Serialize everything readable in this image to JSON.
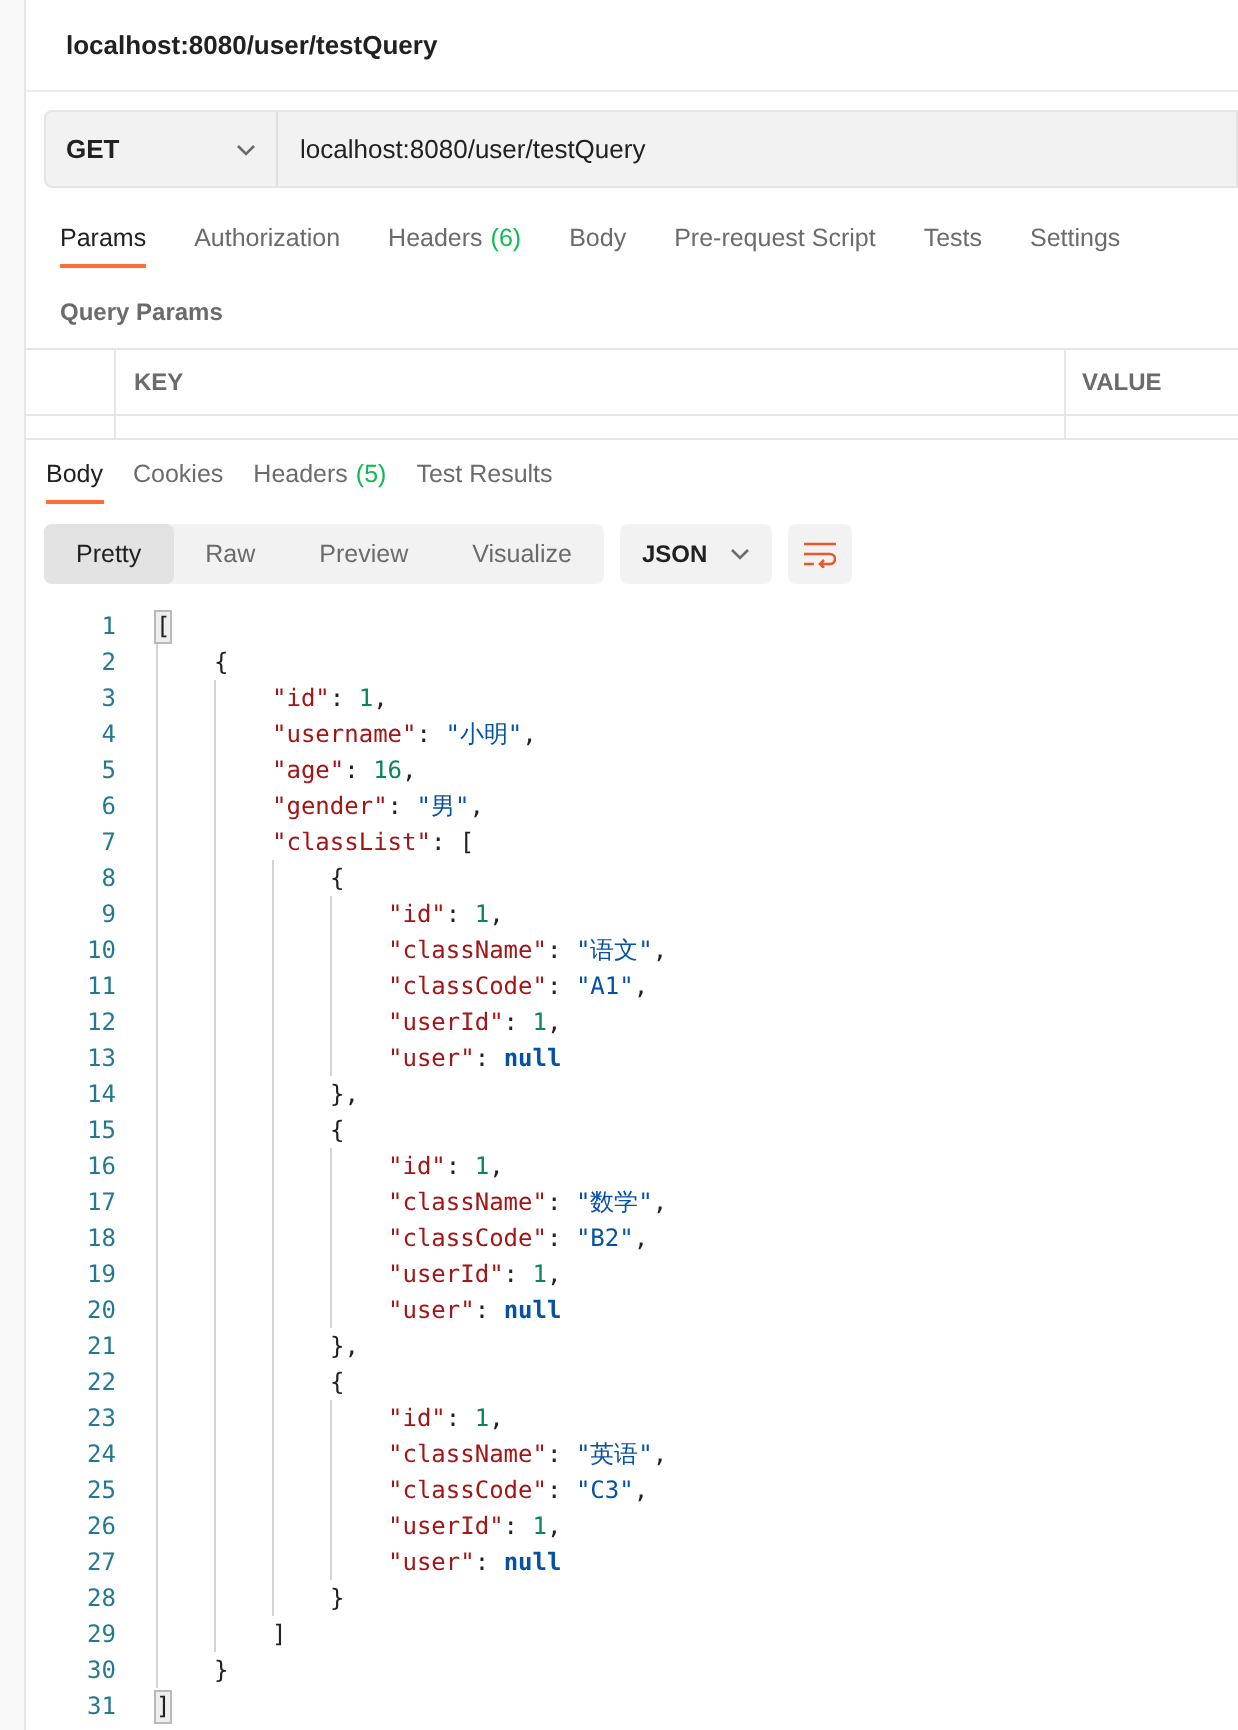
{
  "request_title": "localhost:8080/user/testQuery",
  "request_bar": {
    "method": "GET",
    "url": "localhost:8080/user/testQuery"
  },
  "request_tabs": [
    {
      "label": "Params",
      "selected": true
    },
    {
      "label": "Authorization",
      "selected": false
    },
    {
      "label": "Headers",
      "count": "(6)",
      "selected": false
    },
    {
      "label": "Body",
      "selected": false
    },
    {
      "label": "Pre-request Script",
      "selected": false
    },
    {
      "label": "Tests",
      "selected": false
    },
    {
      "label": "Settings",
      "selected": false
    }
  ],
  "query_params": {
    "title": "Query Params",
    "columns": [
      "KEY",
      "VALUE"
    ]
  },
  "response_tabs": [
    {
      "label": "Body",
      "selected": true
    },
    {
      "label": "Cookies",
      "selected": false
    },
    {
      "label": "Headers",
      "count": "(5)",
      "selected": false
    },
    {
      "label": "Test Results",
      "selected": false
    }
  ],
  "view_modes": [
    {
      "label": "Pretty",
      "selected": true
    },
    {
      "label": "Raw",
      "selected": false
    },
    {
      "label": "Preview",
      "selected": false
    },
    {
      "label": "Visualize",
      "selected": false
    }
  ],
  "format": "JSON",
  "code": [
    {
      "number": "1",
      "highlighted": true,
      "tokens": [
        {
          "kind": "punct",
          "text": "["
        }
      ],
      "children": [
        {
          "number": "2",
          "highlighted": false,
          "tokens": [
            {
              "kind": "punct",
              "text": "{"
            }
          ],
          "children": [
            {
              "number": "3",
              "highlighted": false,
              "tokens": [
                {
                  "kind": "key",
                  "text": "\"id\""
                },
                {
                  "kind": "punct",
                  "text": ": "
                },
                {
                  "kind": "number",
                  "text": "1"
                },
                {
                  "kind": "punct",
                  "text": ","
                }
              ]
            },
            {
              "number": "4",
              "highlighted": false,
              "tokens": [
                {
                  "kind": "key",
                  "text": "\"username\""
                },
                {
                  "kind": "punct",
                  "text": ": "
                },
                {
                  "kind": "string",
                  "text": "\"小明\""
                },
                {
                  "kind": "punct",
                  "text": ","
                }
              ]
            },
            {
              "number": "5",
              "highlighted": false,
              "tokens": [
                {
                  "kind": "key",
                  "text": "\"age\""
                },
                {
                  "kind": "punct",
                  "text": ": "
                },
                {
                  "kind": "number",
                  "text": "16"
                },
                {
                  "kind": "punct",
                  "text": ","
                }
              ]
            },
            {
              "number": "6",
              "highlighted": false,
              "tokens": [
                {
                  "kind": "key",
                  "text": "\"gender\""
                },
                {
                  "kind": "punct",
                  "text": ": "
                },
                {
                  "kind": "string",
                  "text": "\"男\""
                },
                {
                  "kind": "punct",
                  "text": ","
                }
              ]
            },
            {
              "number": "7",
              "highlighted": false,
              "tokens": [
                {
                  "kind": "key",
                  "text": "\"classList\""
                },
                {
                  "kind": "punct",
                  "text": ": ["
                }
              ],
              "children": [
                {
                  "number": "8",
                  "highlighted": false,
                  "tokens": [
                    {
                      "kind": "punct",
                      "text": "{"
                    }
                  ],
                  "children": [
                    {
                      "number": "9",
                      "highlighted": false,
                      "tokens": [
                        {
                          "kind": "key",
                          "text": "\"id\""
                        },
                        {
                          "kind": "punct",
                          "text": ": "
                        },
                        {
                          "kind": "number",
                          "text": "1"
                        },
                        {
                          "kind": "punct",
                          "text": ","
                        }
                      ]
                    },
                    {
                      "number": "10",
                      "highlighted": false,
                      "tokens": [
                        {
                          "kind": "key",
                          "text": "\"className\""
                        },
                        {
                          "kind": "punct",
                          "text": ": "
                        },
                        {
                          "kind": "string",
                          "text": "\"语文\""
                        },
                        {
                          "kind": "punct",
                          "text": ","
                        }
                      ]
                    },
                    {
                      "number": "11",
                      "highlighted": false,
                      "tokens": [
                        {
                          "kind": "key",
                          "text": "\"classCode\""
                        },
                        {
                          "kind": "punct",
                          "text": ": "
                        },
                        {
                          "kind": "string",
                          "text": "\"A1\""
                        },
                        {
                          "kind": "punct",
                          "text": ","
                        }
                      ]
                    },
                    {
                      "number": "12",
                      "highlighted": false,
                      "tokens": [
                        {
                          "kind": "key",
                          "text": "\"userId\""
                        },
                        {
                          "kind": "punct",
                          "text": ": "
                        },
                        {
                          "kind": "number",
                          "text": "1"
                        },
                        {
                          "kind": "punct",
                          "text": ","
                        }
                      ]
                    },
                    {
                      "number": "13",
                      "highlighted": false,
                      "tokens": [
                        {
                          "kind": "key",
                          "text": "\"user\""
                        },
                        {
                          "kind": "punct",
                          "text": ": "
                        },
                        {
                          "kind": "null",
                          "text": "null"
                        }
                      ]
                    }
                  ]
                },
                {
                  "number": "14",
                  "highlighted": false,
                  "tokens": [
                    {
                      "kind": "punct",
                      "text": "},"
                    }
                  ]
                },
                {
                  "number": "15",
                  "highlighted": false,
                  "tokens": [
                    {
                      "kind": "punct",
                      "text": "{"
                    }
                  ],
                  "children": [
                    {
                      "number": "16",
                      "highlighted": false,
                      "tokens": [
                        {
                          "kind": "key",
                          "text": "\"id\""
                        },
                        {
                          "kind": "punct",
                          "text": ": "
                        },
                        {
                          "kind": "number",
                          "text": "1"
                        },
                        {
                          "kind": "punct",
                          "text": ","
                        }
                      ]
                    },
                    {
                      "number": "17",
                      "highlighted": false,
                      "tokens": [
                        {
                          "kind": "key",
                          "text": "\"className\""
                        },
                        {
                          "kind": "punct",
                          "text": ": "
                        },
                        {
                          "kind": "string",
                          "text": "\"数学\""
                        },
                        {
                          "kind": "punct",
                          "text": ","
                        }
                      ]
                    },
                    {
                      "number": "18",
                      "highlighted": false,
                      "tokens": [
                        {
                          "kind": "key",
                          "text": "\"classCode\""
                        },
                        {
                          "kind": "punct",
                          "text": ": "
                        },
                        {
                          "kind": "string",
                          "text": "\"B2\""
                        },
                        {
                          "kind": "punct",
                          "text": ","
                        }
                      ]
                    },
                    {
                      "number": "19",
                      "highlighted": false,
                      "tokens": [
                        {
                          "kind": "key",
                          "text": "\"userId\""
                        },
                        {
                          "kind": "punct",
                          "text": ": "
                        },
                        {
                          "kind": "number",
                          "text": "1"
                        },
                        {
                          "kind": "punct",
                          "text": ","
                        }
                      ]
                    },
                    {
                      "number": "20",
                      "highlighted": false,
                      "tokens": [
                        {
                          "kind": "key",
                          "text": "\"user\""
                        },
                        {
                          "kind": "punct",
                          "text": ": "
                        },
                        {
                          "kind": "null",
                          "text": "null"
                        }
                      ]
                    }
                  ]
                },
                {
                  "number": "21",
                  "highlighted": false,
                  "tokens": [
                    {
                      "kind": "punct",
                      "text": "},"
                    }
                  ]
                },
                {
                  "number": "22",
                  "highlighted": false,
                  "tokens": [
                    {
                      "kind": "punct",
                      "text": "{"
                    }
                  ],
                  "children": [
                    {
                      "number": "23",
                      "highlighted": false,
                      "tokens": [
                        {
                          "kind": "key",
                          "text": "\"id\""
                        },
                        {
                          "kind": "punct",
                          "text": ": "
                        },
                        {
                          "kind": "number",
                          "text": "1"
                        },
                        {
                          "kind": "punct",
                          "text": ","
                        }
                      ]
                    },
                    {
                      "number": "24",
                      "highlighted": false,
                      "tokens": [
                        {
                          "kind": "key",
                          "text": "\"className\""
                        },
                        {
                          "kind": "punct",
                          "text": ": "
                        },
                        {
                          "kind": "string",
                          "text": "\"英语\""
                        },
                        {
                          "kind": "punct",
                          "text": ","
                        }
                      ]
                    },
                    {
                      "number": "25",
                      "highlighted": false,
                      "tokens": [
                        {
                          "kind": "key",
                          "text": "\"classCode\""
                        },
                        {
                          "kind": "punct",
                          "text": ": "
                        },
                        {
                          "kind": "string",
                          "text": "\"C3\""
                        },
                        {
                          "kind": "punct",
                          "text": ","
                        }
                      ]
                    },
                    {
                      "number": "26",
                      "highlighted": false,
                      "tokens": [
                        {
                          "kind": "key",
                          "text": "\"userId\""
                        },
                        {
                          "kind": "punct",
                          "text": ": "
                        },
                        {
                          "kind": "number",
                          "text": "1"
                        },
                        {
                          "kind": "punct",
                          "text": ","
                        }
                      ]
                    },
                    {
                      "number": "27",
                      "highlighted": false,
                      "tokens": [
                        {
                          "kind": "key",
                          "text": "\"user\""
                        },
                        {
                          "kind": "punct",
                          "text": ": "
                        },
                        {
                          "kind": "null",
                          "text": "null"
                        }
                      ]
                    }
                  ]
                },
                {
                  "number": "28",
                  "highlighted": false,
                  "tokens": [
                    {
                      "kind": "punct",
                      "text": "}"
                    }
                  ]
                }
              ]
            },
            {
              "number": "29",
              "highlighted": false,
              "tokens": [
                {
                  "kind": "punct",
                  "text": "]"
                }
              ]
            }
          ]
        },
        {
          "number": "30",
          "highlighted": false,
          "tokens": [
            {
              "kind": "punct",
              "text": "}"
            }
          ]
        }
      ]
    },
    {
      "number": "31",
      "highlighted": true,
      "tokens": [
        {
          "kind": "punct",
          "text": "]"
        }
      ]
    }
  ]
}
